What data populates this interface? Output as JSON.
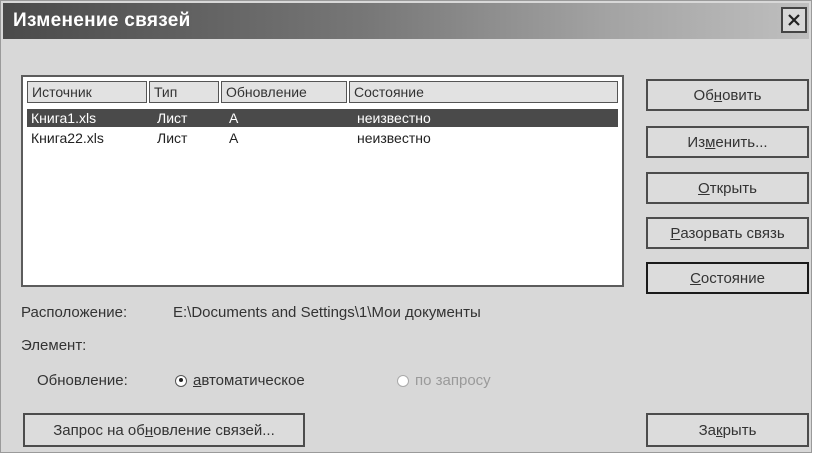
{
  "window": {
    "title": "Изменение связей",
    "close_icon": "close-icon"
  },
  "links_table": {
    "columns": [
      "Источник",
      "Тип",
      "Обновление",
      "Состояние"
    ],
    "rows": [
      {
        "source": "Книга1.xls",
        "type": "Лист",
        "update": "A",
        "state": "неизвестно",
        "selected": true
      },
      {
        "source": "Книга22.xls",
        "type": "Лист",
        "update": "A",
        "state": "неизвестно",
        "selected": false
      }
    ]
  },
  "buttons": {
    "update": {
      "pre": "Об",
      "acc": "н",
      "post": "овить"
    },
    "change": {
      "pre": "Из",
      "acc": "м",
      "post": "енить..."
    },
    "open": {
      "pre": "",
      "acc": "О",
      "post": "ткрыть"
    },
    "break": {
      "pre": "",
      "acc": "Р",
      "post": "азорвать связь"
    },
    "status": {
      "pre": "",
      "acc": "С",
      "post": "остояние"
    },
    "request_update": {
      "pre": "Запрос на об",
      "acc": "н",
      "post": "овление связей..."
    },
    "close": {
      "pre": "За",
      "acc": "к",
      "post": "рыть"
    }
  },
  "info": {
    "location_label": "Расположение:",
    "location_value": "E:\\Documents and Settings\\1\\Мои документы",
    "element_label": "Элемент:",
    "update_label": "Обновление:"
  },
  "update_mode": {
    "auto": {
      "pre": "",
      "acc": "а",
      "post": "втоматическое",
      "checked": true
    },
    "manual": {
      "label": "по запросу",
      "checked": false,
      "enabled": false
    }
  }
}
